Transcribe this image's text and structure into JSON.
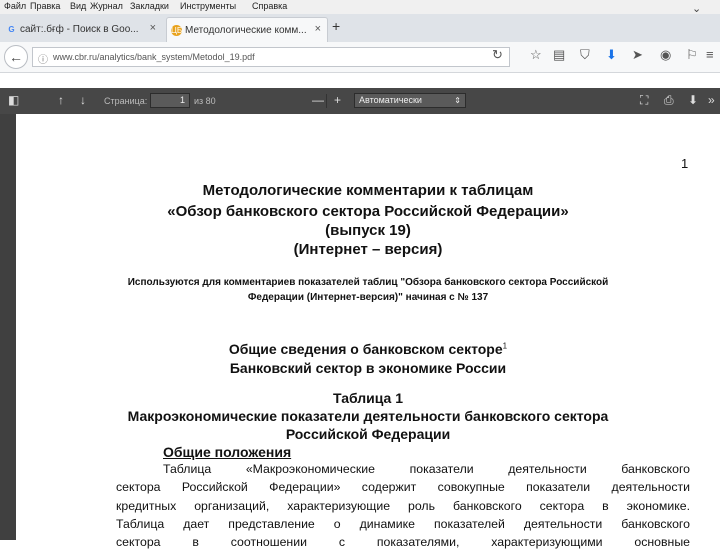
{
  "menu": [
    "Файл",
    "Правка",
    "Вид",
    "Журнал",
    "Закладки",
    "Инструменты",
    "Справка"
  ],
  "tabs": [
    {
      "label": "сайт:.бғф - Поиск в Goo...",
      "favicon": "G",
      "active": false
    },
    {
      "label": "Методологические комм...",
      "favicon": "ЦБ",
      "active": true
    }
  ],
  "new_tab": "+",
  "address": {
    "url": "www.cbr.ru/analytics/bank_system/Metodol_19.pdf"
  },
  "pdf_toolbar": {
    "page_label": "Страница:",
    "page_value": "1",
    "page_total": "из 80",
    "zoom_minus": "—",
    "zoom_plus": "+",
    "zoom_value": "Автоматически"
  },
  "document": {
    "page_number": "1",
    "title_lines": [
      "Методологические комментарии к таблицам",
      "«Обзор банковского сектора Российской Федерации»",
      "(выпуск 19)",
      "(Интернет – версия)"
    ],
    "usage_lines": [
      "Используются для комментариев показателей таблиц \"Обзора банковского сектора Российской",
      "Федерации (Интернет-версия)\" начиная с № 137"
    ],
    "section_title": "Общие сведения о банковском секторе",
    "section_footnote": "1",
    "section_subtitle": "Банковский сектор в экономике России",
    "table_title": "Таблица 1",
    "table_name_lines": [
      "Макроэкономические показатели деятельности банковского сектора",
      "Российской Федерации"
    ],
    "general_heading": "Общие положения",
    "body_lines": [
      "Таблица «Макроэкономические показатели деятельности банковского",
      "сектора Российской Федерации» содержит совокупные показатели деятельности",
      "кредитных организаций, характеризующие роль банковского сектора в экономике.",
      "Таблица дает представление о динамике показателей деятельности банковского",
      "сектора в соотношении с показателями, характеризующими основные"
    ]
  }
}
